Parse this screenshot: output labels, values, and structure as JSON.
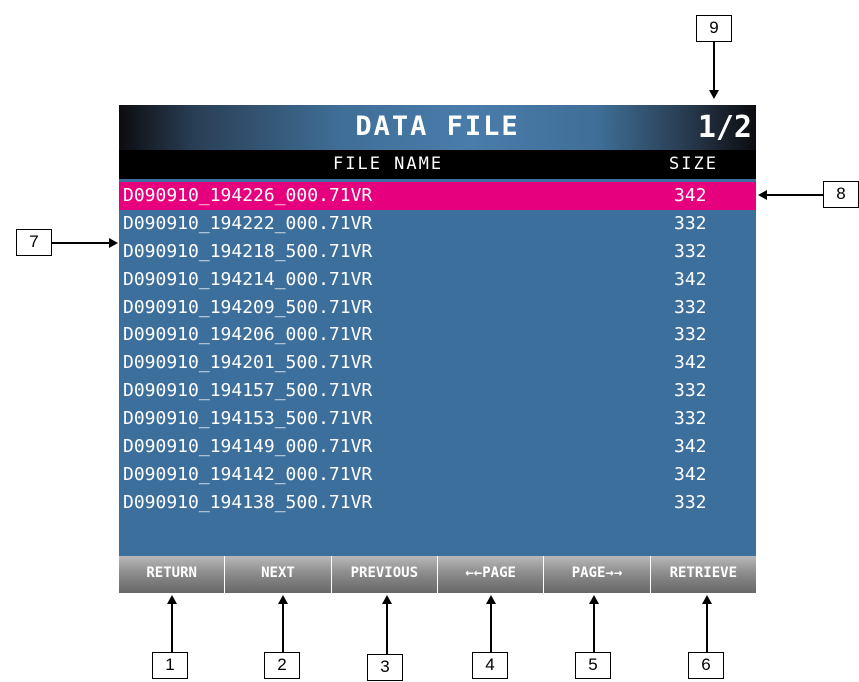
{
  "header": {
    "title": "DATA FILE",
    "page": "1/2"
  },
  "columns": {
    "name": "FILE NAME",
    "size": "SIZE"
  },
  "files": [
    {
      "name": "D090910_194226_000.71VR",
      "size": "342",
      "selected": true
    },
    {
      "name": "D090910_194222_000.71VR",
      "size": "332"
    },
    {
      "name": "D090910_194218_500.71VR",
      "size": "332"
    },
    {
      "name": "D090910_194214_000.71VR",
      "size": "342"
    },
    {
      "name": "D090910_194209_500.71VR",
      "size": "332"
    },
    {
      "name": "D090910_194206_000.71VR",
      "size": "332"
    },
    {
      "name": "D090910_194201_500.71VR",
      "size": "342"
    },
    {
      "name": "D090910_194157_500.71VR",
      "size": "332"
    },
    {
      "name": "D090910_194153_500.71VR",
      "size": "332"
    },
    {
      "name": "D090910_194149_000.71VR",
      "size": "342"
    },
    {
      "name": "D090910_194142_000.71VR",
      "size": "342"
    },
    {
      "name": "D090910_194138_500.71VR",
      "size": "332"
    }
  ],
  "buttons": {
    "return": "RETURN",
    "next": "NEXT",
    "previous": "PREVIOUS",
    "page_back": "←←PAGE",
    "page_forward": "PAGE→→",
    "retrieve": "RETRIEVE"
  },
  "callouts": {
    "c1": "1",
    "c2": "2",
    "c3": "3",
    "c4": "4",
    "c5": "5",
    "c6": "6",
    "c7": "7",
    "c8": "8",
    "c9": "9"
  },
  "colors": {
    "panel_blue": "#3d6f9c",
    "selection_magenta": "#e6007e",
    "header_black": "#000000",
    "button_gray": "#8d8d8d"
  }
}
